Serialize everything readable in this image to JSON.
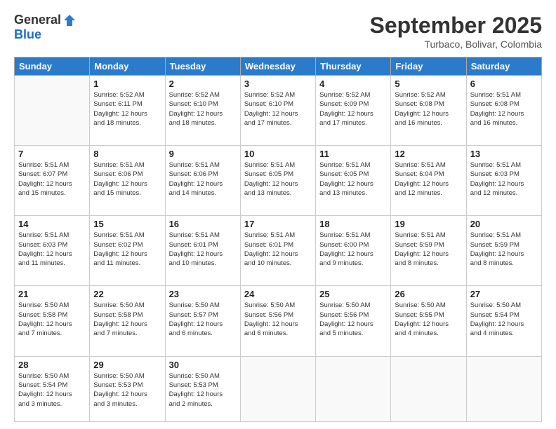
{
  "logo": {
    "general": "General",
    "blue": "Blue"
  },
  "title": "September 2025",
  "subtitle": "Turbaco, Bolivar, Colombia",
  "days": [
    "Sunday",
    "Monday",
    "Tuesday",
    "Wednesday",
    "Thursday",
    "Friday",
    "Saturday"
  ],
  "weeks": [
    [
      {
        "day": "",
        "info": ""
      },
      {
        "day": "1",
        "info": "Sunrise: 5:52 AM\nSunset: 6:11 PM\nDaylight: 12 hours\nand 18 minutes."
      },
      {
        "day": "2",
        "info": "Sunrise: 5:52 AM\nSunset: 6:10 PM\nDaylight: 12 hours\nand 18 minutes."
      },
      {
        "day": "3",
        "info": "Sunrise: 5:52 AM\nSunset: 6:10 PM\nDaylight: 12 hours\nand 17 minutes."
      },
      {
        "day": "4",
        "info": "Sunrise: 5:52 AM\nSunset: 6:09 PM\nDaylight: 12 hours\nand 17 minutes."
      },
      {
        "day": "5",
        "info": "Sunrise: 5:52 AM\nSunset: 6:08 PM\nDaylight: 12 hours\nand 16 minutes."
      },
      {
        "day": "6",
        "info": "Sunrise: 5:51 AM\nSunset: 6:08 PM\nDaylight: 12 hours\nand 16 minutes."
      }
    ],
    [
      {
        "day": "7",
        "info": "Sunrise: 5:51 AM\nSunset: 6:07 PM\nDaylight: 12 hours\nand 15 minutes."
      },
      {
        "day": "8",
        "info": "Sunrise: 5:51 AM\nSunset: 6:06 PM\nDaylight: 12 hours\nand 15 minutes."
      },
      {
        "day": "9",
        "info": "Sunrise: 5:51 AM\nSunset: 6:06 PM\nDaylight: 12 hours\nand 14 minutes."
      },
      {
        "day": "10",
        "info": "Sunrise: 5:51 AM\nSunset: 6:05 PM\nDaylight: 12 hours\nand 13 minutes."
      },
      {
        "day": "11",
        "info": "Sunrise: 5:51 AM\nSunset: 6:05 PM\nDaylight: 12 hours\nand 13 minutes."
      },
      {
        "day": "12",
        "info": "Sunrise: 5:51 AM\nSunset: 6:04 PM\nDaylight: 12 hours\nand 12 minutes."
      },
      {
        "day": "13",
        "info": "Sunrise: 5:51 AM\nSunset: 6:03 PM\nDaylight: 12 hours\nand 12 minutes."
      }
    ],
    [
      {
        "day": "14",
        "info": "Sunrise: 5:51 AM\nSunset: 6:03 PM\nDaylight: 12 hours\nand 11 minutes."
      },
      {
        "day": "15",
        "info": "Sunrise: 5:51 AM\nSunset: 6:02 PM\nDaylight: 12 hours\nand 11 minutes."
      },
      {
        "day": "16",
        "info": "Sunrise: 5:51 AM\nSunset: 6:01 PM\nDaylight: 12 hours\nand 10 minutes."
      },
      {
        "day": "17",
        "info": "Sunrise: 5:51 AM\nSunset: 6:01 PM\nDaylight: 12 hours\nand 10 minutes."
      },
      {
        "day": "18",
        "info": "Sunrise: 5:51 AM\nSunset: 6:00 PM\nDaylight: 12 hours\nand 9 minutes."
      },
      {
        "day": "19",
        "info": "Sunrise: 5:51 AM\nSunset: 5:59 PM\nDaylight: 12 hours\nand 8 minutes."
      },
      {
        "day": "20",
        "info": "Sunrise: 5:51 AM\nSunset: 5:59 PM\nDaylight: 12 hours\nand 8 minutes."
      }
    ],
    [
      {
        "day": "21",
        "info": "Sunrise: 5:50 AM\nSunset: 5:58 PM\nDaylight: 12 hours\nand 7 minutes."
      },
      {
        "day": "22",
        "info": "Sunrise: 5:50 AM\nSunset: 5:58 PM\nDaylight: 12 hours\nand 7 minutes."
      },
      {
        "day": "23",
        "info": "Sunrise: 5:50 AM\nSunset: 5:57 PM\nDaylight: 12 hours\nand 6 minutes."
      },
      {
        "day": "24",
        "info": "Sunrise: 5:50 AM\nSunset: 5:56 PM\nDaylight: 12 hours\nand 6 minutes."
      },
      {
        "day": "25",
        "info": "Sunrise: 5:50 AM\nSunset: 5:56 PM\nDaylight: 12 hours\nand 5 minutes."
      },
      {
        "day": "26",
        "info": "Sunrise: 5:50 AM\nSunset: 5:55 PM\nDaylight: 12 hours\nand 4 minutes."
      },
      {
        "day": "27",
        "info": "Sunrise: 5:50 AM\nSunset: 5:54 PM\nDaylight: 12 hours\nand 4 minutes."
      }
    ],
    [
      {
        "day": "28",
        "info": "Sunrise: 5:50 AM\nSunset: 5:54 PM\nDaylight: 12 hours\nand 3 minutes."
      },
      {
        "day": "29",
        "info": "Sunrise: 5:50 AM\nSunset: 5:53 PM\nDaylight: 12 hours\nand 3 minutes."
      },
      {
        "day": "30",
        "info": "Sunrise: 5:50 AM\nSunset: 5:53 PM\nDaylight: 12 hours\nand 2 minutes."
      },
      {
        "day": "",
        "info": ""
      },
      {
        "day": "",
        "info": ""
      },
      {
        "day": "",
        "info": ""
      },
      {
        "day": "",
        "info": ""
      }
    ]
  ]
}
